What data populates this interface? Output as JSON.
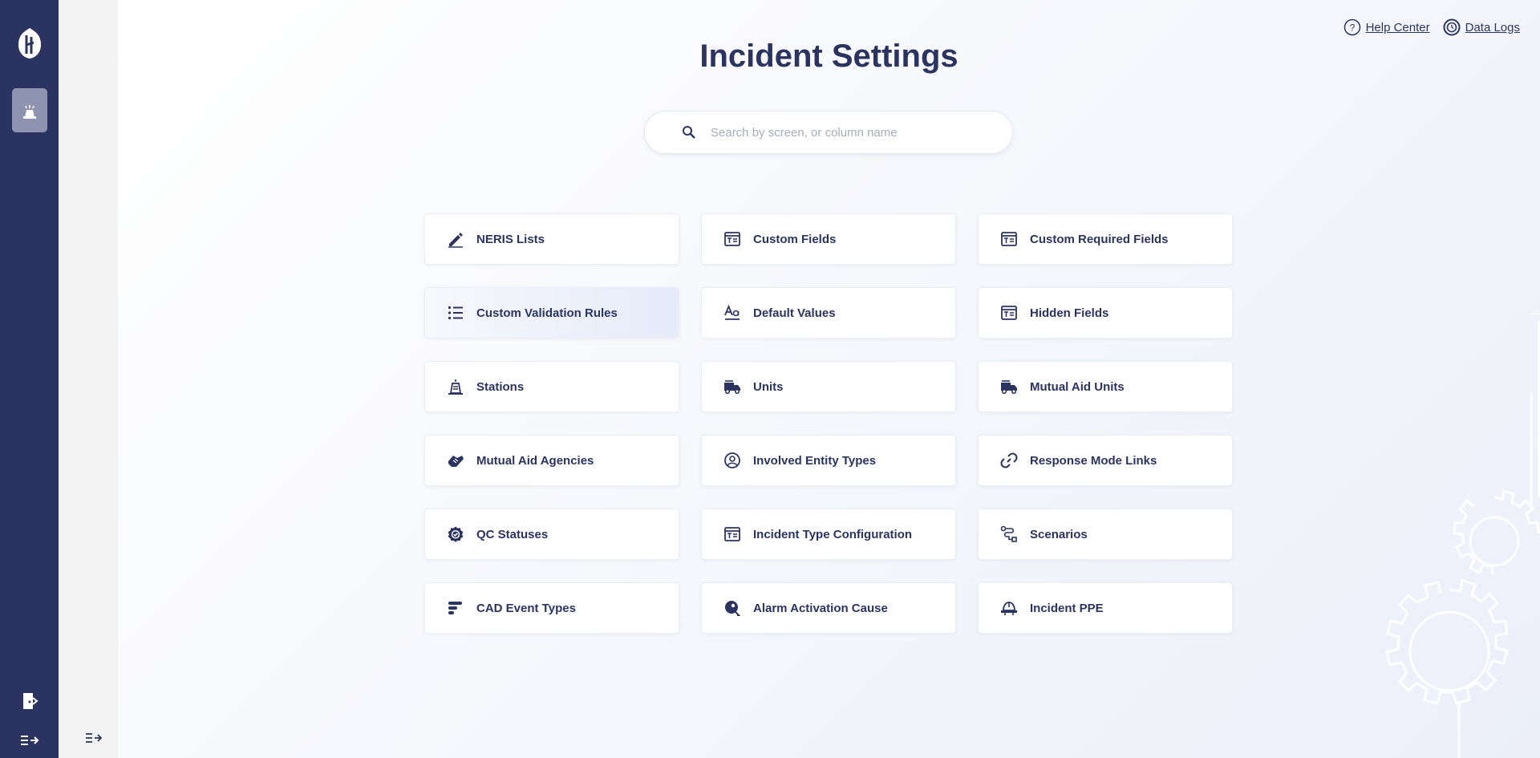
{
  "header": {
    "title": "Incident Settings",
    "links": [
      {
        "label": "Help Center",
        "icon": "help-circle-icon"
      },
      {
        "label": "Data Logs",
        "icon": "history-icon"
      }
    ]
  },
  "search": {
    "placeholder": "Search by screen, or column name",
    "value": ""
  },
  "cards": [
    {
      "label": "NERIS Lists",
      "icon": "pen-icon"
    },
    {
      "label": "Custom Fields",
      "icon": "form-table-icon"
    },
    {
      "label": "Custom Required Fields",
      "icon": "form-table-icon"
    },
    {
      "label": "Custom Validation Rules",
      "icon": "list-icon"
    },
    {
      "label": "Default Values",
      "icon": "text-style-icon"
    },
    {
      "label": "Hidden Fields",
      "icon": "form-table-icon"
    },
    {
      "label": "Stations",
      "icon": "fire-station-icon"
    },
    {
      "label": "Units",
      "icon": "fire-truck-icon"
    },
    {
      "label": "Mutual Aid Units",
      "icon": "fire-truck-icon"
    },
    {
      "label": "Mutual Aid Agencies",
      "icon": "handshake-icon"
    },
    {
      "label": "Involved Entity Types",
      "icon": "person-circle-icon"
    },
    {
      "label": "Response Mode Links",
      "icon": "link-icon"
    },
    {
      "label": "QC Statuses",
      "icon": "badge-check-icon"
    },
    {
      "label": "Incident Type Configuration",
      "icon": "form-table-icon"
    },
    {
      "label": "Scenarios",
      "icon": "route-icon"
    },
    {
      "label": "CAD Event Types",
      "icon": "bars-icon"
    },
    {
      "label": "Alarm Activation Cause",
      "icon": "alarm-icon"
    },
    {
      "label": "Incident PPE",
      "icon": "helmet-icon"
    }
  ],
  "colors": {
    "sidebar": "#2b3461",
    "accent": "#2b3461",
    "subpanel": "#f3f3f3",
    "card_hover": "#e6ebfa"
  }
}
